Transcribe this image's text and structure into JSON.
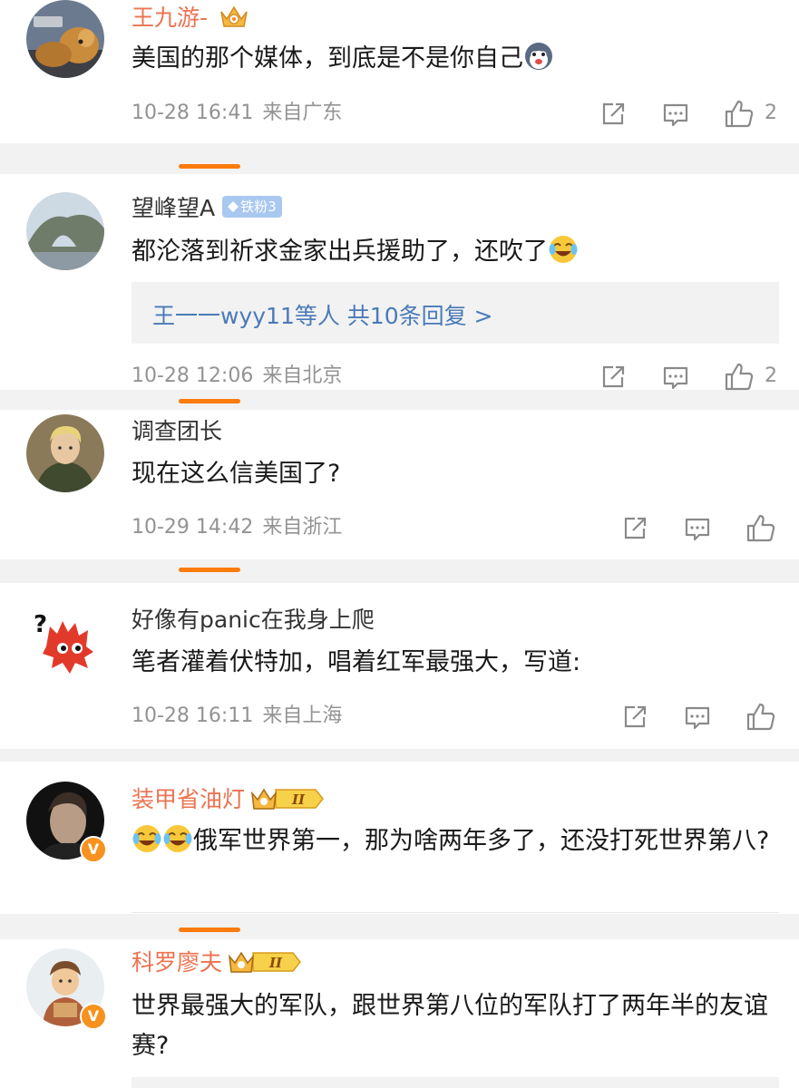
{
  "comments": [
    {
      "username": "王九游-",
      "text": "美国的那个媒体，到底是不是你自己",
      "time": "10-28 16:41",
      "location": "来自广东",
      "likes": "2",
      "avatar": "dog-avatar",
      "badge": "crown-vip-badge"
    },
    {
      "username": "望峰望A",
      "badge_text": "铁粉3",
      "text": "都沦落到祈求金家出兵援助了，还吹了",
      "reply_summary": "王一一wyy11等人 共10条回复 >",
      "time": "10-28 12:06",
      "location": "来自北京",
      "likes": "2",
      "avatar": "karst-rock-avatar"
    },
    {
      "username": "调查团长",
      "text": "现在这么信美国了?",
      "time": "10-29 14:42",
      "location": "来自浙江",
      "likes": "",
      "avatar": "anime-commander-avatar"
    },
    {
      "username": "好像有panic在我身上爬",
      "text": "笔者灌着伏特加，唱着红军最强大，写道:",
      "time": "10-28 16:11",
      "location": "来自上海",
      "likes": "",
      "avatar": "red-crab-avatar"
    },
    {
      "username": "装甲省油灯",
      "text": "俄军世界第一，那为啥两年多了，还没打死世界第八?",
      "avatar": "man-portrait-avatar",
      "badge": "crown-level-II-badge",
      "verified": "V"
    },
    {
      "username": "科罗廖夫",
      "text": "世界最强大的军队，跟世界第八位的军队打了两年半的友谊赛?",
      "avatar": "cartoon-character-avatar",
      "badge": "crown-level-II-badge",
      "verified": "V"
    }
  ],
  "level_badge_text": "II",
  "colors": {
    "orange_name": "#eb7350",
    "accent_bar": "#fb7b0c",
    "meta_gray": "#939393",
    "link_blue": "#4a7ab8",
    "iron_fan_blue": "#a9c8f0"
  }
}
